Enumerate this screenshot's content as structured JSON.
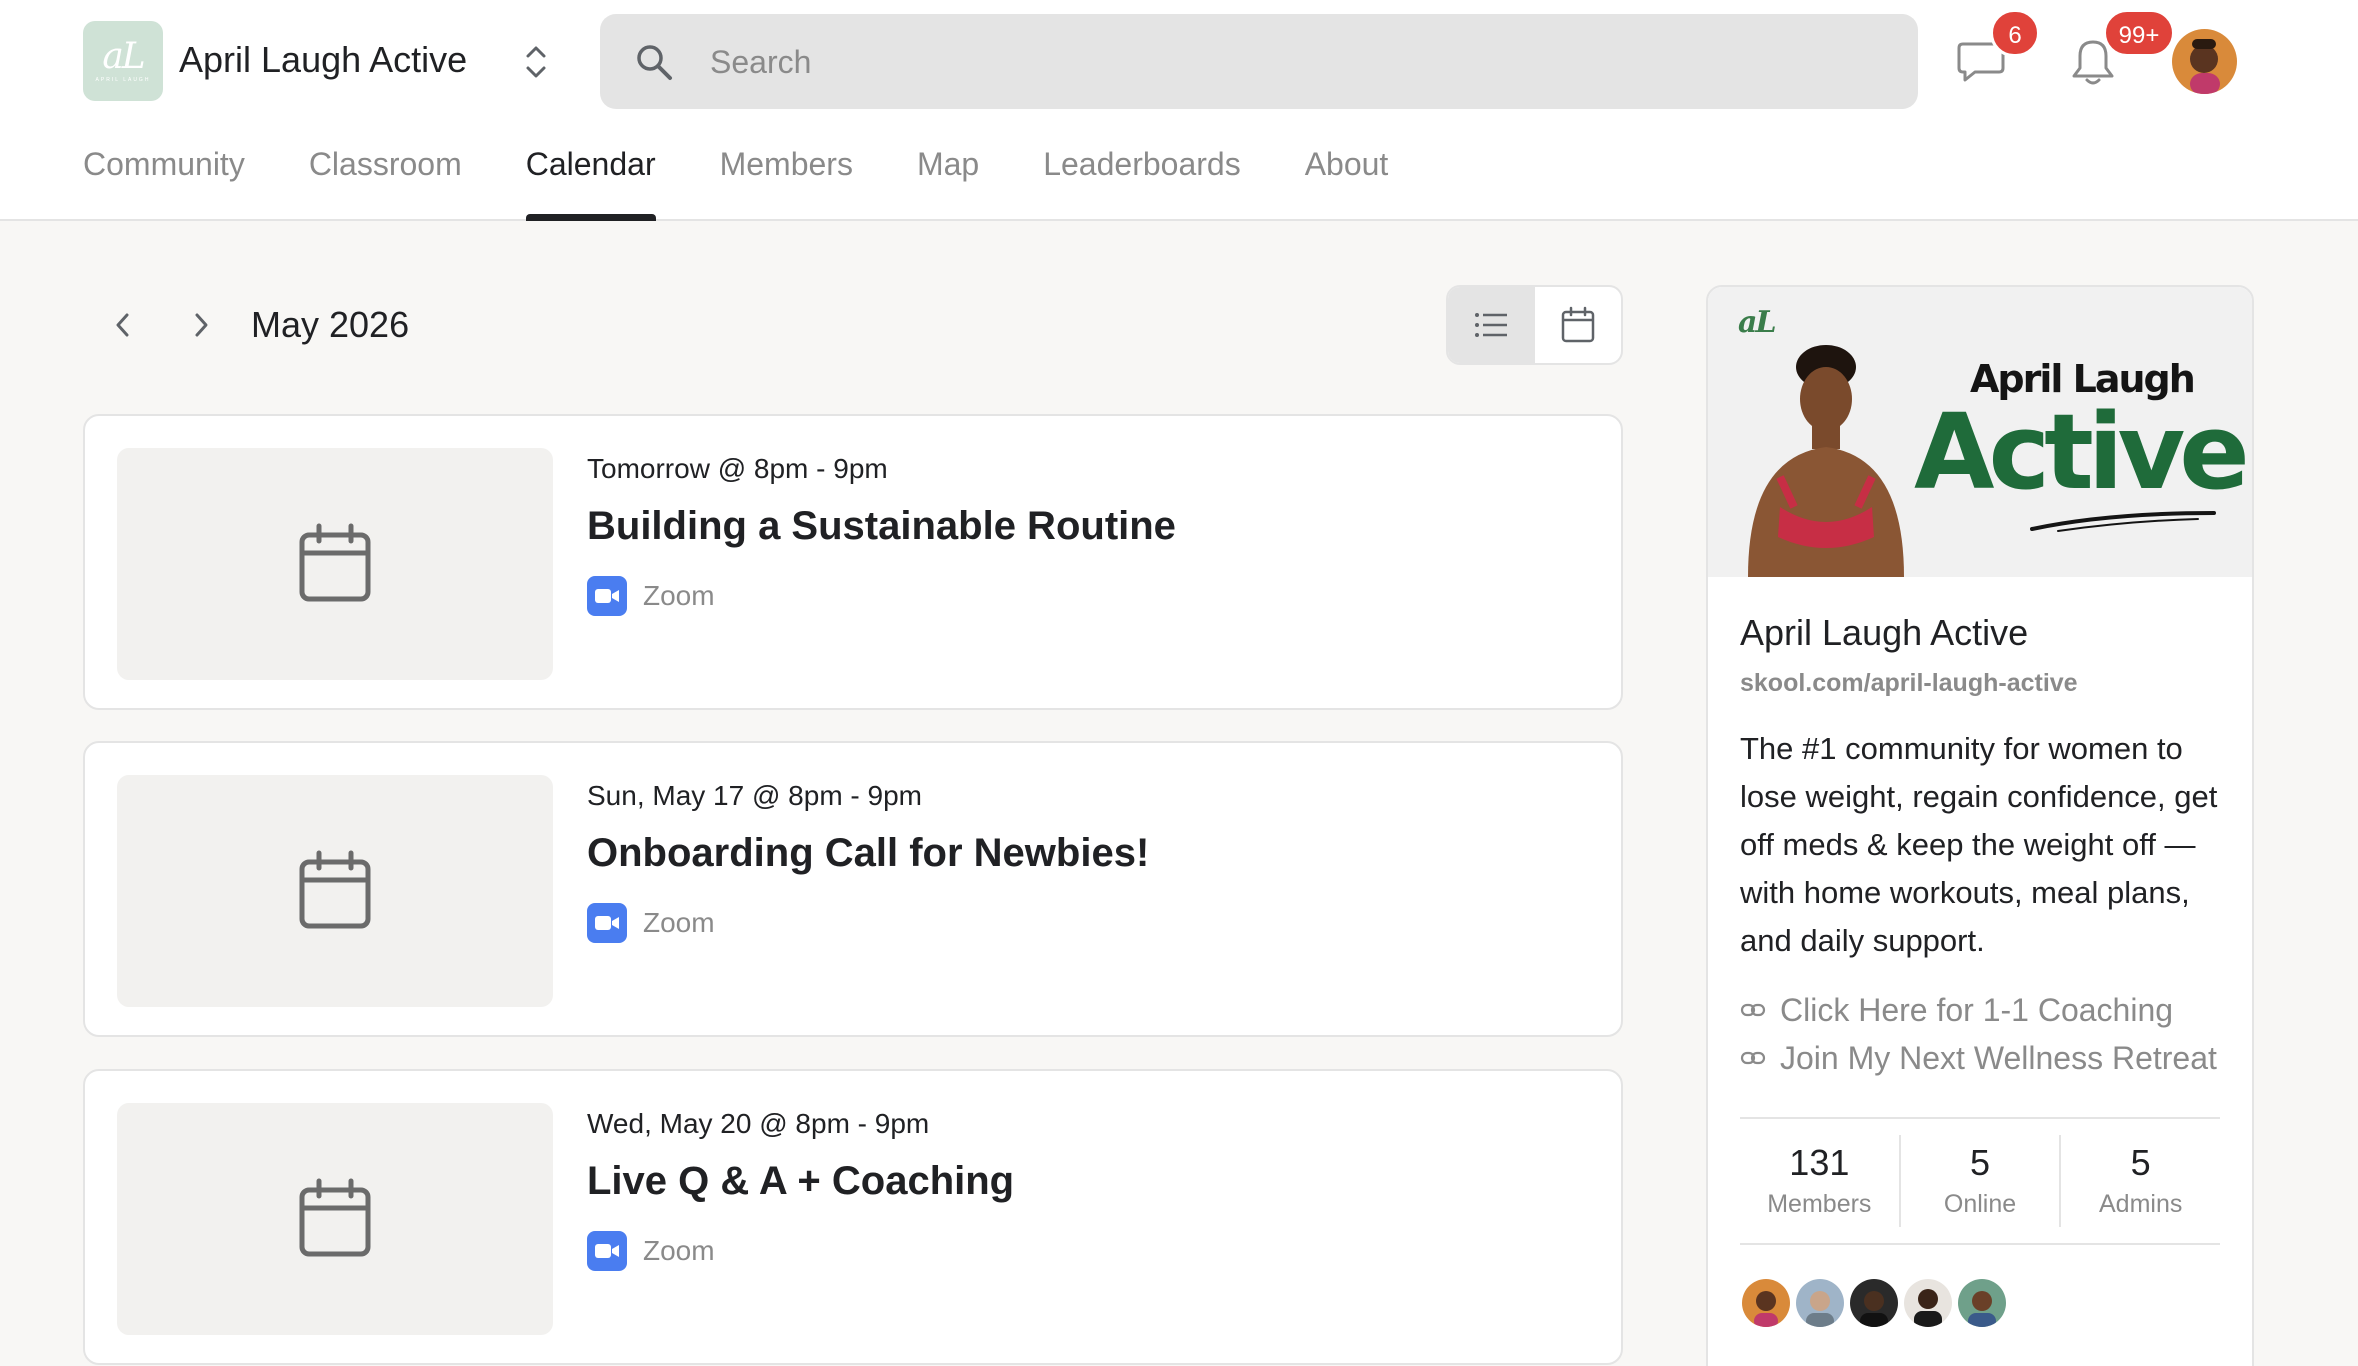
{
  "header": {
    "group_name": "April Laugh Active",
    "logo_text": "aL",
    "logo_subtext": "APRIL LAUGH",
    "search_placeholder": "Search",
    "chat_badge": "6",
    "notifications_badge": "99+"
  },
  "tabs": [
    {
      "label": "Community",
      "active": false
    },
    {
      "label": "Classroom",
      "active": false
    },
    {
      "label": "Calendar",
      "active": true
    },
    {
      "label": "Members",
      "active": false
    },
    {
      "label": "Map",
      "active": false
    },
    {
      "label": "Leaderboards",
      "active": false
    },
    {
      "label": "About",
      "active": false
    }
  ],
  "calendar": {
    "month": "May 2026",
    "view": "list"
  },
  "events": [
    {
      "when": "Tomorrow @ 8pm - 9pm",
      "title": "Building a Sustainable Routine",
      "platform": "Zoom"
    },
    {
      "when": "Sun, May 17 @ 8pm - 9pm",
      "title": "Onboarding Call for Newbies!",
      "platform": "Zoom"
    },
    {
      "when": "Wed, May 20 @ 8pm - 9pm",
      "title": "Live Q & A + Coaching",
      "platform": "Zoom"
    }
  ],
  "sidebar": {
    "banner_logo": "aL",
    "banner_line1": "April Laugh",
    "banner_line2": "Active",
    "title": "April Laugh Active",
    "url": "skool.com/april-laugh-active",
    "description": "The #1 community for women to lose weight, regain confidence, get off meds & keep the weight off — with home workouts, meal plans, and daily support.",
    "links": [
      {
        "label": "Click Here for 1-1 Coaching",
        "icon": "link-icon"
      },
      {
        "label": "Join My Next Wellness Retreat",
        "icon": "link-icon"
      }
    ],
    "stats": [
      {
        "value": "131",
        "label": "Members"
      },
      {
        "value": "5",
        "label": "Online"
      },
      {
        "value": "5",
        "label": "Admins"
      }
    ]
  },
  "colors": {
    "accent": "#202124",
    "muted": "#8a8a8a",
    "badge": "#e0423a",
    "zoom": "#4a7df0",
    "brand_green": "#1f6b3a"
  }
}
